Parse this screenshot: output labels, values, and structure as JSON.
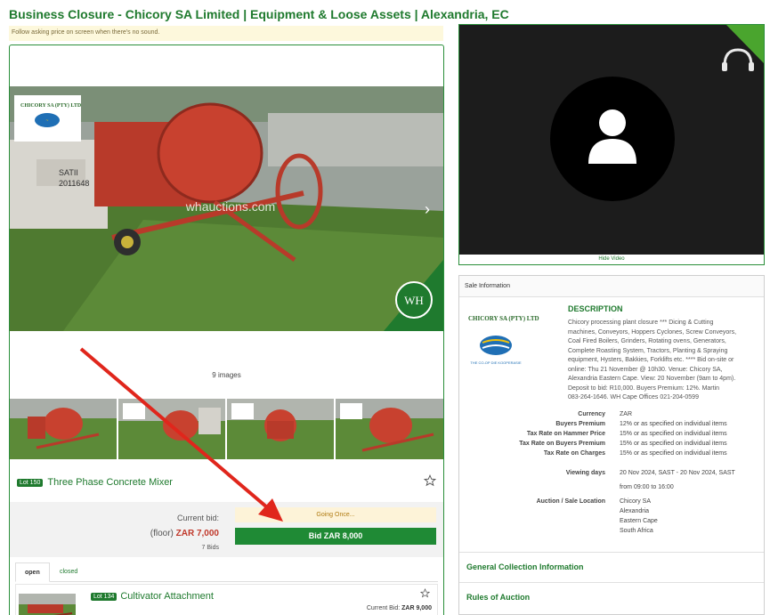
{
  "page": {
    "title": "Business Closure - Chicory SA Limited | Equipment & Loose Assets | Alexandria, EC",
    "notice": "Follow asking price on screen when there's no sound."
  },
  "lot": {
    "image_count": "9 images",
    "watermark": "whauctions.com",
    "logo_text": "CHICORY SA (PTY) LTD",
    "lot_badge": "Lot 150",
    "name": "Three Phase Concrete Mixer",
    "current_bid_label": "Current bid:",
    "floor_prefix": "(floor)",
    "floor_amount": "ZAR 7,000",
    "bids_count": "7 Bids",
    "status": "Going Once...",
    "bid_button": "Bid ZAR 8,000"
  },
  "tabs": {
    "open": "open",
    "closed": "closed"
  },
  "next_lot": {
    "badge": "Lot 134",
    "name": "Cultivator Attachment",
    "current_bid_label": "Current Bid:",
    "current_bid": "ZAR 9,000"
  },
  "video": {
    "hide_label": "Hide Video"
  },
  "sale": {
    "header": "Sale Information",
    "logo_text": "CHICORY SA (PTY) LTD",
    "logo_sub": "THE CO-OP DIE KOOPERASIE",
    "desc_title": "DESCRIPTION",
    "desc_lines": [
      "Chicory processing plant closure *** Dicing & Cutting",
      "machines, Conveyors, Hoppers Cyclones, Screw Conveyors,",
      "Coal Fired Boilers, Grinders, Rotating ovens, Generators,",
      "Complete Roasting System, Tractors, Planting & Spraying",
      "equipment, Hysters, Bakkies, Forklifts etc. **** Bid on-site or",
      "online: Thu 21 November @ 10h30. Venue: Chicory SA,",
      "Alexandria Eastern Cape. View: 20 November (9am to 4pm).",
      "Deposit to bid: R10,000. Buyers Premium: 12%. Martin",
      "083-264-1646. WH Cape Offices 021-204-0599"
    ],
    "currency_label": "Currency",
    "currency": "ZAR",
    "bp_label": "Buyers Premium",
    "bp": "12% or as specified on individual items",
    "tax_hammer_label": "Tax Rate on Hammer Price",
    "tax_hammer": "15% or as specified on individual items",
    "tax_bp_label": "Tax Rate on Buyers Premium",
    "tax_bp": "15% or as specified on individual items",
    "tax_charges_label": "Tax Rate on Charges",
    "tax_charges": "15% or as specified on individual items",
    "viewing_label": "Viewing days",
    "viewing_1": "20 Nov 2024, SAST - 20 Nov 2024, SAST",
    "viewing_2": "from 09:00 to 16:00",
    "location_label": "Auction / Sale Location",
    "location_lines": [
      "Chicory SA",
      "Alexandria",
      "Eastern Cape",
      "South Africa"
    ],
    "general_collection": "General Collection Information",
    "rules": "Rules of Auction"
  },
  "colors": {
    "brand_green": "#1f7a2e",
    "bid_button": "#1f8a35",
    "arrow": "#e0261c"
  }
}
